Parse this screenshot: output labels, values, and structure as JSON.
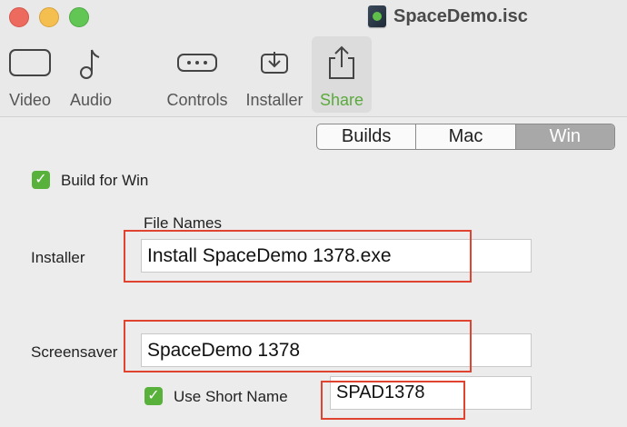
{
  "window": {
    "title": "SpaceDemo.isc"
  },
  "toolbar": {
    "items": [
      {
        "label": "Video",
        "icon": "video-icon"
      },
      {
        "label": "Audio",
        "icon": "music-note-icon"
      },
      {
        "label": "Controls",
        "icon": "controls-icon"
      },
      {
        "label": "Installer",
        "icon": "installer-icon"
      },
      {
        "label": "Share",
        "icon": "share-icon",
        "active": true
      }
    ]
  },
  "segmented": {
    "items": [
      "Builds",
      "Mac",
      "Win"
    ],
    "selected": "Win"
  },
  "build": {
    "label": "Build for Win",
    "checked": true
  },
  "file_names": {
    "header": "File Names",
    "installer_label": "Installer",
    "installer_value": "Install SpaceDemo 1378.exe",
    "screensaver_label": "Screensaver",
    "screensaver_value": "SpaceDemo 1378",
    "short_name_label": "Use Short Name",
    "short_name_checked": true,
    "short_name_value": "SPAD1378"
  },
  "colors": {
    "accent_green": "#58b13b",
    "highlight_red": "#e0432f"
  }
}
